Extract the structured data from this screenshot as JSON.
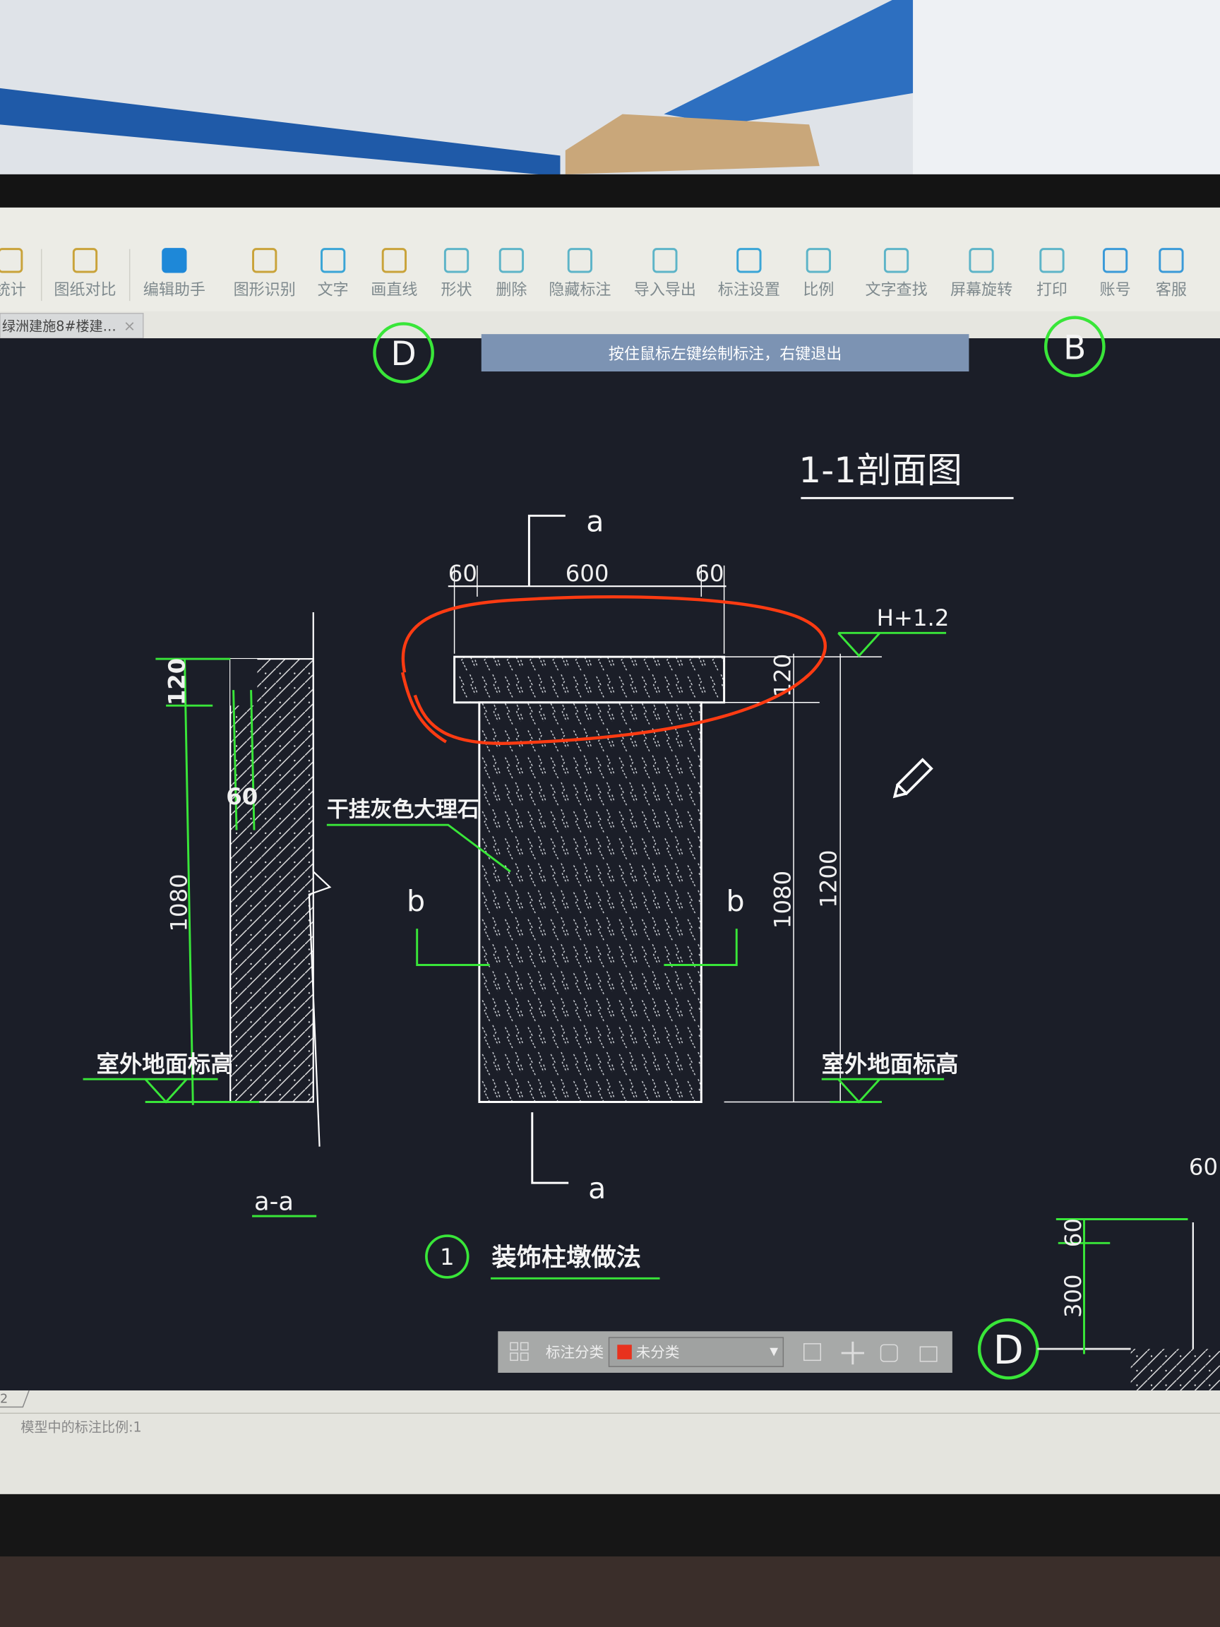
{
  "toolbar": {
    "items": [
      {
        "label": "统计",
        "icon": "statistics-icon"
      },
      {
        "label": "图纸对比",
        "icon": "compare-icon"
      },
      {
        "label": "编辑助手",
        "icon": "edit-assistant-icon"
      },
      {
        "label": "图形识别",
        "icon": "shape-recognition-icon"
      },
      {
        "label": "文字",
        "icon": "text-icon"
      },
      {
        "label": "画直线",
        "icon": "line-icon"
      },
      {
        "label": "形状",
        "icon": "shape-icon"
      },
      {
        "label": "删除",
        "icon": "eraser-icon"
      },
      {
        "label": "隐藏标注",
        "icon": "hide-annotation-icon"
      },
      {
        "label": "导入导出",
        "icon": "import-export-icon"
      },
      {
        "label": "标注设置",
        "icon": "annotation-settings-icon"
      },
      {
        "label": "比例",
        "icon": "scale-icon"
      },
      {
        "label": "文字查找",
        "icon": "text-search-icon"
      },
      {
        "label": "屏幕旋转",
        "icon": "rotate-icon"
      },
      {
        "label": "打印",
        "icon": "print-icon"
      },
      {
        "label": "账号",
        "icon": "account-icon"
      },
      {
        "label": "客服",
        "icon": "support-icon"
      }
    ]
  },
  "tab": {
    "label": "绿洲建施8#楼建…",
    "close": "×"
  },
  "hint": "按住鼠标左键绘制标注，右键退出",
  "drawing": {
    "axis_d": "D",
    "axis_b": "B",
    "section_title": "1-1剖面图",
    "section_a": "a",
    "section_b": "b",
    "dims_top": [
      "60",
      "600",
      "60"
    ],
    "elevation": "H+1.2",
    "dim_120": "120",
    "dim_1080": "1080",
    "dim_1200": "1200",
    "dim_60": "60",
    "dim_300": "300",
    "material": "干挂灰色大理石",
    "ground_label": "室外地面标高",
    "aa_label": "a-a",
    "detail_no": "1",
    "detail_title": "装饰柱墩做法"
  },
  "annotation_bar": {
    "label": "标注分类",
    "selected": "未分类",
    "category_color": "#e8321e"
  },
  "layout_tab": "2",
  "status": "模型中的标注比例:1",
  "colors": {
    "canvas": "#1b1e28",
    "cad_green": "#39e639",
    "markup_red": "#ff3b12"
  }
}
